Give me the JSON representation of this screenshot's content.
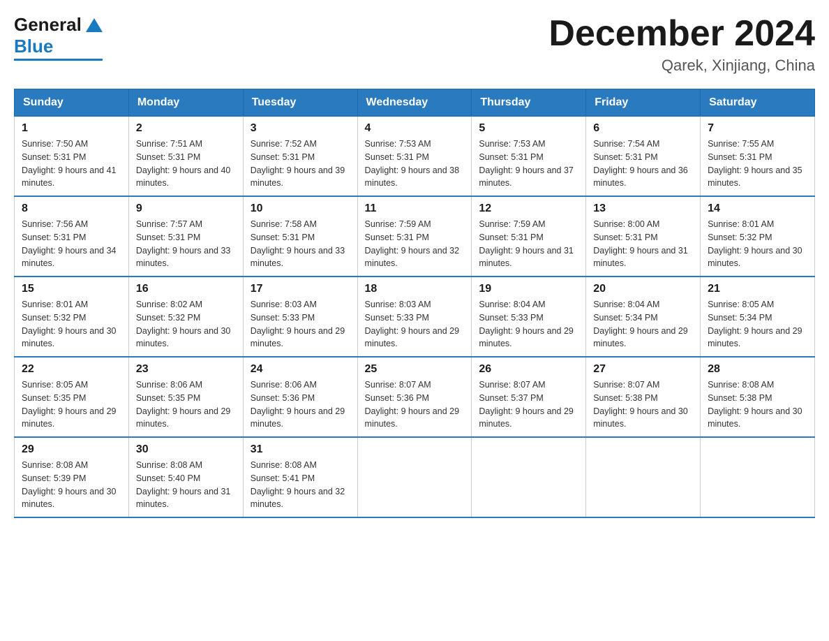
{
  "header": {
    "logo_general": "General",
    "logo_blue": "Blue",
    "month_title": "December 2024",
    "location": "Qarek, Xinjiang, China"
  },
  "weekdays": [
    "Sunday",
    "Monday",
    "Tuesday",
    "Wednesday",
    "Thursday",
    "Friday",
    "Saturday"
  ],
  "weeks": [
    [
      {
        "day": "1",
        "sunrise": "7:50 AM",
        "sunset": "5:31 PM",
        "daylight": "9 hours and 41 minutes."
      },
      {
        "day": "2",
        "sunrise": "7:51 AM",
        "sunset": "5:31 PM",
        "daylight": "9 hours and 40 minutes."
      },
      {
        "day": "3",
        "sunrise": "7:52 AM",
        "sunset": "5:31 PM",
        "daylight": "9 hours and 39 minutes."
      },
      {
        "day": "4",
        "sunrise": "7:53 AM",
        "sunset": "5:31 PM",
        "daylight": "9 hours and 38 minutes."
      },
      {
        "day": "5",
        "sunrise": "7:53 AM",
        "sunset": "5:31 PM",
        "daylight": "9 hours and 37 minutes."
      },
      {
        "day": "6",
        "sunrise": "7:54 AM",
        "sunset": "5:31 PM",
        "daylight": "9 hours and 36 minutes."
      },
      {
        "day": "7",
        "sunrise": "7:55 AM",
        "sunset": "5:31 PM",
        "daylight": "9 hours and 35 minutes."
      }
    ],
    [
      {
        "day": "8",
        "sunrise": "7:56 AM",
        "sunset": "5:31 PM",
        "daylight": "9 hours and 34 minutes."
      },
      {
        "day": "9",
        "sunrise": "7:57 AM",
        "sunset": "5:31 PM",
        "daylight": "9 hours and 33 minutes."
      },
      {
        "day": "10",
        "sunrise": "7:58 AM",
        "sunset": "5:31 PM",
        "daylight": "9 hours and 33 minutes."
      },
      {
        "day": "11",
        "sunrise": "7:59 AM",
        "sunset": "5:31 PM",
        "daylight": "9 hours and 32 minutes."
      },
      {
        "day": "12",
        "sunrise": "7:59 AM",
        "sunset": "5:31 PM",
        "daylight": "9 hours and 31 minutes."
      },
      {
        "day": "13",
        "sunrise": "8:00 AM",
        "sunset": "5:31 PM",
        "daylight": "9 hours and 31 minutes."
      },
      {
        "day": "14",
        "sunrise": "8:01 AM",
        "sunset": "5:32 PM",
        "daylight": "9 hours and 30 minutes."
      }
    ],
    [
      {
        "day": "15",
        "sunrise": "8:01 AM",
        "sunset": "5:32 PM",
        "daylight": "9 hours and 30 minutes."
      },
      {
        "day": "16",
        "sunrise": "8:02 AM",
        "sunset": "5:32 PM",
        "daylight": "9 hours and 30 minutes."
      },
      {
        "day": "17",
        "sunrise": "8:03 AM",
        "sunset": "5:33 PM",
        "daylight": "9 hours and 29 minutes."
      },
      {
        "day": "18",
        "sunrise": "8:03 AM",
        "sunset": "5:33 PM",
        "daylight": "9 hours and 29 minutes."
      },
      {
        "day": "19",
        "sunrise": "8:04 AM",
        "sunset": "5:33 PM",
        "daylight": "9 hours and 29 minutes."
      },
      {
        "day": "20",
        "sunrise": "8:04 AM",
        "sunset": "5:34 PM",
        "daylight": "9 hours and 29 minutes."
      },
      {
        "day": "21",
        "sunrise": "8:05 AM",
        "sunset": "5:34 PM",
        "daylight": "9 hours and 29 minutes."
      }
    ],
    [
      {
        "day": "22",
        "sunrise": "8:05 AM",
        "sunset": "5:35 PM",
        "daylight": "9 hours and 29 minutes."
      },
      {
        "day": "23",
        "sunrise": "8:06 AM",
        "sunset": "5:35 PM",
        "daylight": "9 hours and 29 minutes."
      },
      {
        "day": "24",
        "sunrise": "8:06 AM",
        "sunset": "5:36 PM",
        "daylight": "9 hours and 29 minutes."
      },
      {
        "day": "25",
        "sunrise": "8:07 AM",
        "sunset": "5:36 PM",
        "daylight": "9 hours and 29 minutes."
      },
      {
        "day": "26",
        "sunrise": "8:07 AM",
        "sunset": "5:37 PM",
        "daylight": "9 hours and 29 minutes."
      },
      {
        "day": "27",
        "sunrise": "8:07 AM",
        "sunset": "5:38 PM",
        "daylight": "9 hours and 30 minutes."
      },
      {
        "day": "28",
        "sunrise": "8:08 AM",
        "sunset": "5:38 PM",
        "daylight": "9 hours and 30 minutes."
      }
    ],
    [
      {
        "day": "29",
        "sunrise": "8:08 AM",
        "sunset": "5:39 PM",
        "daylight": "9 hours and 30 minutes."
      },
      {
        "day": "30",
        "sunrise": "8:08 AM",
        "sunset": "5:40 PM",
        "daylight": "9 hours and 31 minutes."
      },
      {
        "day": "31",
        "sunrise": "8:08 AM",
        "sunset": "5:41 PM",
        "daylight": "9 hours and 32 minutes."
      },
      null,
      null,
      null,
      null
    ]
  ]
}
